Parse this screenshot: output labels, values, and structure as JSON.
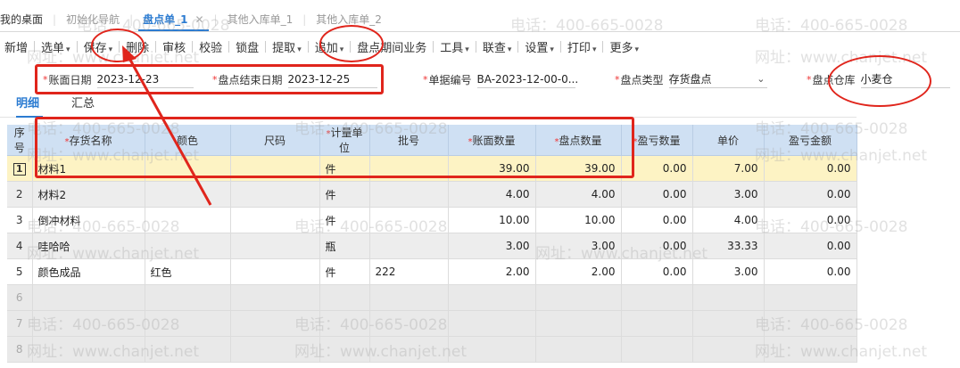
{
  "tabs": [
    {
      "label": "我的桌面"
    },
    {
      "label": "初始化导航"
    },
    {
      "label": "盘点单_1"
    },
    {
      "label": "其他入库单_1"
    },
    {
      "label": "其他入库单_2"
    }
  ],
  "tab_close_glyph": "✕",
  "toolbar": {
    "items": [
      "新增",
      "选单",
      "保存",
      "删除",
      "审核",
      "校验",
      "锁盘",
      "提取",
      "追加",
      "盘点期间业务",
      "工具",
      "联查",
      "设置",
      "打印",
      "更多"
    ]
  },
  "header": {
    "account_date_label": "账面日期",
    "account_date_value": "2023-12-23",
    "end_date_label": "盘点结束日期",
    "end_date_value": "2023-12-25",
    "doc_no_label": "单据编号",
    "doc_no_value": "BA-2023-12-00-0...",
    "type_label": "盘点类型",
    "type_value": "存货盘点",
    "warehouse_label": "盘点仓库",
    "warehouse_value": "小麦仓"
  },
  "subtabs": {
    "detail": "明细",
    "summary": "汇总"
  },
  "grid": {
    "columns": [
      "序号",
      "存货名称",
      "颜色",
      "尺码",
      "计量单位",
      "批号",
      "账面数量",
      "盘点数量",
      "盈亏数量",
      "单价",
      "盈亏金额"
    ],
    "rows": [
      {
        "seq": "1",
        "name": "材料1",
        "color": "",
        "size": "",
        "unit": "件",
        "batch": "",
        "book_qty": "39.00",
        "count_qty": "39.00",
        "diff_qty": "0.00",
        "price": "7.00",
        "diff_amt": "0.00"
      },
      {
        "seq": "2",
        "name": "材料2",
        "color": "",
        "size": "",
        "unit": "件",
        "batch": "",
        "book_qty": "4.00",
        "count_qty": "4.00",
        "diff_qty": "0.00",
        "price": "3.00",
        "diff_amt": "0.00"
      },
      {
        "seq": "3",
        "name": "倒冲材料",
        "color": "",
        "size": "",
        "unit": "件",
        "batch": "",
        "book_qty": "10.00",
        "count_qty": "10.00",
        "diff_qty": "0.00",
        "price": "4.00",
        "diff_amt": "0.00"
      },
      {
        "seq": "4",
        "name": "哇哈哈",
        "color": "",
        "size": "",
        "unit": "瓶",
        "batch": "",
        "book_qty": "3.00",
        "count_qty": "3.00",
        "diff_qty": "0.00",
        "price": "33.33",
        "diff_amt": "0.00"
      },
      {
        "seq": "5",
        "name": "颜色成品",
        "color": "红色",
        "size": "",
        "unit": "件",
        "batch": "222",
        "book_qty": "2.00",
        "count_qty": "2.00",
        "diff_qty": "0.00",
        "price": "3.00",
        "diff_amt": "0.00"
      }
    ],
    "empty_rows": [
      "6",
      "7",
      "8"
    ]
  },
  "watermark": {
    "phone": "电话：400-665-0028",
    "site": "网址：www.chanjet.net"
  },
  "colors": {
    "accent": "#2b7bd1",
    "annotation_red": "#e0251c",
    "header_blue": "#cfe0f3",
    "selected_row": "#fdf3c4"
  }
}
